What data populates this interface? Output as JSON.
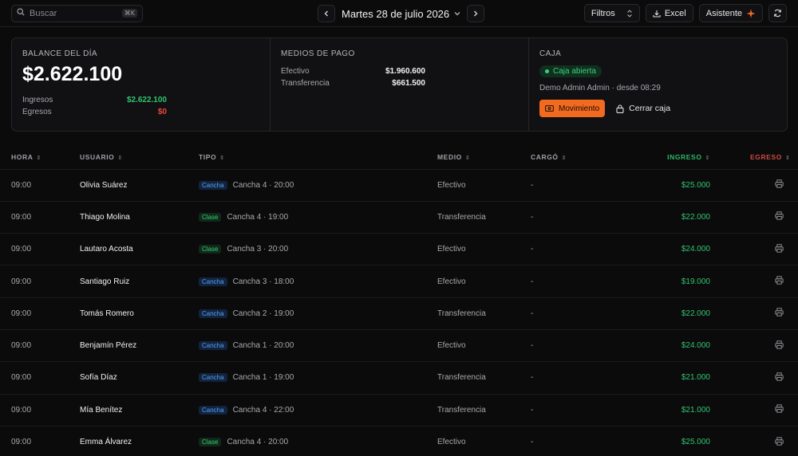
{
  "topbar": {
    "search_placeholder": "Buscar",
    "search_shortcut": "⌘K",
    "date": "Martes 28 de julio 2026",
    "filters": "Filtros",
    "excel": "Excel",
    "assistant": "Asistente"
  },
  "balance": {
    "title": "BALANCE DEL DÍA",
    "total": "$2.622.100",
    "ingresos_label": "Ingresos",
    "ingresos_value": "$2.622.100",
    "egresos_label": "Egresos",
    "egresos_value": "$0"
  },
  "payments": {
    "title": "MEDIOS DE PAGO",
    "efectivo_label": "Efectivo",
    "efectivo_value": "$1.960.600",
    "transfer_label": "Transferencia",
    "transfer_value": "$661.500"
  },
  "caja": {
    "title": "CAJA",
    "status": "Caja abierta",
    "since": "Demo Admin Admin · desde 08:29",
    "movimiento": "Movimiento",
    "cerrar": "Cerrar caja"
  },
  "table": {
    "headers": {
      "hora": "HORA",
      "usuario": "USUARIO",
      "tipo": "TIPO",
      "medio": "MEDIO",
      "cargo": "CARGÓ",
      "ingreso": "INGRESO",
      "egreso": "EGRESO"
    },
    "rows": [
      {
        "hora": "09:00",
        "usuario": "Olivia Suárez",
        "tag": "Cancha",
        "detalle": "Cancha 4 · 20:00",
        "medio": "Efectivo",
        "cargo": "-",
        "ingreso": "$25.000"
      },
      {
        "hora": "09:00",
        "usuario": "Thiago Molina",
        "tag": "Clase",
        "detalle": "Cancha 4 · 19:00",
        "medio": "Transferencia",
        "cargo": "-",
        "ingreso": "$22.000"
      },
      {
        "hora": "09:00",
        "usuario": "Lautaro Acosta",
        "tag": "Clase",
        "detalle": "Cancha 3 · 20:00",
        "medio": "Efectivo",
        "cargo": "-",
        "ingreso": "$24.000"
      },
      {
        "hora": "09:00",
        "usuario": "Santiago Ruiz",
        "tag": "Cancha",
        "detalle": "Cancha 3 · 18:00",
        "medio": "Efectivo",
        "cargo": "-",
        "ingreso": "$19.000"
      },
      {
        "hora": "09:00",
        "usuario": "Tomás Romero",
        "tag": "Cancha",
        "detalle": "Cancha 2 · 19:00",
        "medio": "Transferencia",
        "cargo": "-",
        "ingreso": "$22.000"
      },
      {
        "hora": "09:00",
        "usuario": "Benjamín Pérez",
        "tag": "Cancha",
        "detalle": "Cancha 1 · 20:00",
        "medio": "Efectivo",
        "cargo": "-",
        "ingreso": "$24.000"
      },
      {
        "hora": "09:00",
        "usuario": "Sofía Díaz",
        "tag": "Cancha",
        "detalle": "Cancha 1 · 19:00",
        "medio": "Transferencia",
        "cargo": "-",
        "ingreso": "$21.000"
      },
      {
        "hora": "09:00",
        "usuario": "Mía Benítez",
        "tag": "Cancha",
        "detalle": "Cancha 4 · 22:00",
        "medio": "Transferencia",
        "cargo": "-",
        "ingreso": "$21.000"
      },
      {
        "hora": "09:00",
        "usuario": "Emma Álvarez",
        "tag": "Clase",
        "detalle": "Cancha 4 · 20:00",
        "medio": "Efectivo",
        "cargo": "-",
        "ingreso": "$25.000"
      }
    ]
  }
}
